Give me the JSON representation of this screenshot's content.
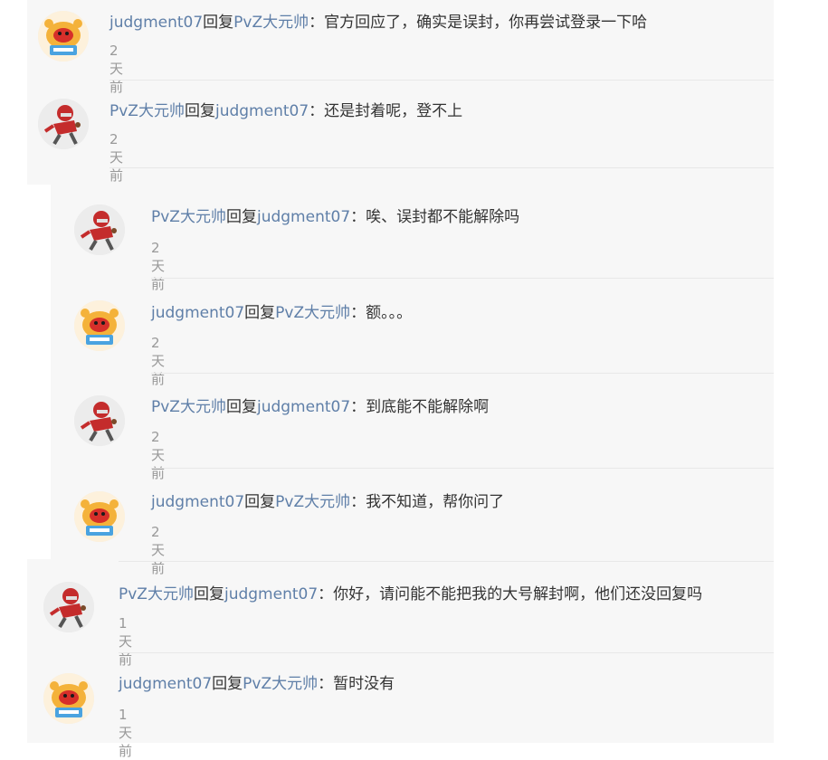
{
  "replies": [
    {
      "author": "judgment07",
      "verb": "回复",
      "target": "PvZ大元帅",
      "sep": "：",
      "text": "官方回应了，确实是误封，你再尝试登录一下哈",
      "time": "2天前",
      "avatar": "judgment07"
    },
    {
      "author": "PvZ大元帅",
      "verb": "回复",
      "target": "judgment07",
      "sep": "：",
      "text": "还是封着呢，登不上",
      "time": "2天前",
      "avatar": "pvz"
    },
    {
      "author": "PvZ大元帅",
      "verb": "回复",
      "target": "judgment07",
      "sep": "：",
      "text": "唉、误封都不能解除吗",
      "time": "2天前",
      "avatar": "pvz"
    },
    {
      "author": "judgment07",
      "verb": "回复",
      "target": "PvZ大元帅",
      "sep": "：",
      "text": "额。。。",
      "time": "2天前",
      "avatar": "judgment07"
    },
    {
      "author": "PvZ大元帅",
      "verb": "回复",
      "target": "judgment07",
      "sep": "：",
      "text": "到底能不能解除啊",
      "time": "2天前",
      "avatar": "pvz"
    },
    {
      "author": "judgment07",
      "verb": "回复",
      "target": "PvZ大元帅",
      "sep": "：",
      "text": "我不知道，帮你问了",
      "time": "2天前",
      "avatar": "judgment07"
    },
    {
      "author": "PvZ大元帅",
      "verb": "回复",
      "target": "judgment07",
      "sep": "：",
      "text": "你好，请问能不能把我的大号解封啊，他们还没回复吗",
      "time": "1天前",
      "avatar": "pvz"
    },
    {
      "author": "judgment07",
      "verb": "回复",
      "target": "PvZ大元帅",
      "sep": "：",
      "text": "暂时没有",
      "time": "1天前",
      "avatar": "judgment07"
    }
  ],
  "colors": {
    "link": "#5f7fa8",
    "text": "#333333",
    "time": "#999999",
    "panel": "#f7f7f7",
    "divider": "#e8e8e8"
  }
}
